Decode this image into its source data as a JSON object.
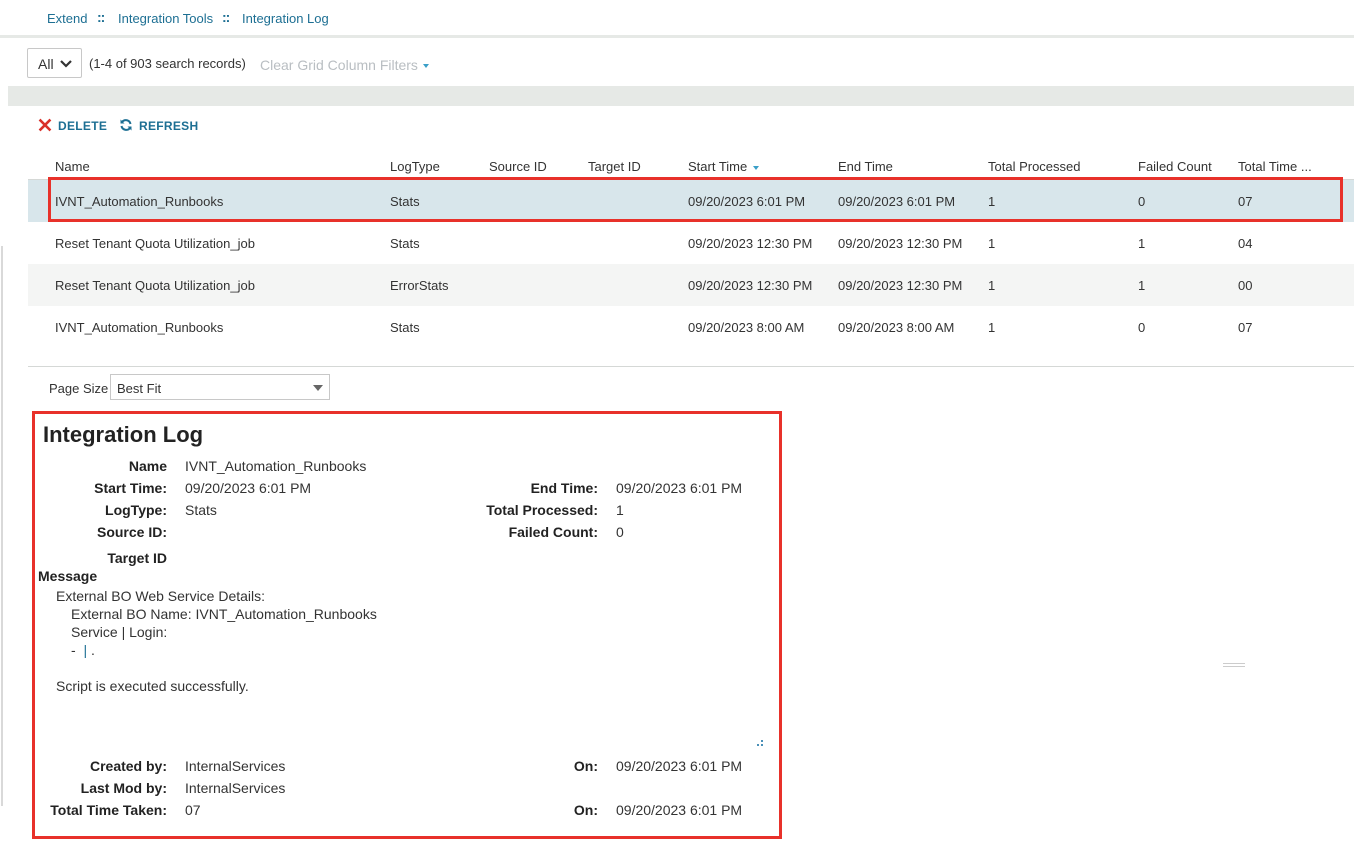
{
  "breadcrumb": {
    "items": [
      "Extend",
      "Integration Tools",
      "Integration Log"
    ],
    "separator": "::"
  },
  "filter": {
    "scope_value": "All",
    "records_text": "(1-4 of 903 search records)",
    "clear_filters_label": "Clear Grid Column Filters"
  },
  "toolbar": {
    "delete_label": "DELETE",
    "refresh_label": "REFRESH"
  },
  "grid": {
    "columns": [
      "Name",
      "LogType",
      "Source ID",
      "Target ID",
      "Start Time",
      "End Time",
      "Total Processed",
      "Failed Count",
      "Total Time ..."
    ],
    "sorted_column": "Start Time",
    "rows": [
      {
        "name": "IVNT_Automation_Runbooks",
        "logtype": "Stats",
        "source_id": "",
        "target_id": "",
        "start": "09/20/2023 6:01 PM",
        "end": "09/20/2023 6:01 PM",
        "processed": "1",
        "failed": "0",
        "total_time": "07"
      },
      {
        "name": "Reset Tenant Quota Utilization_job",
        "logtype": "Stats",
        "source_id": "",
        "target_id": "",
        "start": "09/20/2023 12:30 PM",
        "end": "09/20/2023 12:30 PM",
        "processed": "1",
        "failed": "1",
        "total_time": "04"
      },
      {
        "name": "Reset Tenant Quota Utilization_job",
        "logtype": "ErrorStats",
        "source_id": "",
        "target_id": "",
        "start": "09/20/2023 12:30 PM",
        "end": "09/20/2023 12:30 PM",
        "processed": "1",
        "failed": "1",
        "total_time": "00"
      },
      {
        "name": "IVNT_Automation_Runbooks",
        "logtype": "Stats",
        "source_id": "",
        "target_id": "",
        "start": "09/20/2023 8:00 AM",
        "end": "09/20/2023 8:00 AM",
        "processed": "1",
        "failed": "0",
        "total_time": "07"
      }
    ],
    "page_size_label": "Page Size",
    "page_size_value": "Best Fit"
  },
  "detail": {
    "title": "Integration Log",
    "labels": {
      "name": "Name",
      "start_time": "Start Time:",
      "end_time": "End Time:",
      "logtype": "LogType:",
      "total_processed": "Total Processed:",
      "source_id": "Source ID:",
      "failed_count": "Failed Count:",
      "target_id": "Target ID",
      "message": "Message",
      "created_by": "Created by:",
      "created_on": "On:",
      "last_mod_by": "Last Mod by:",
      "total_time_taken": "Total Time Taken:",
      "last_mod_on": "On:"
    },
    "values": {
      "name": "IVNT_Automation_Runbooks",
      "start_time": "09/20/2023 6:01 PM",
      "end_time": "09/20/2023 6:01 PM",
      "logtype": "Stats",
      "total_processed": "1",
      "source_id": "",
      "failed_count": "0",
      "target_id": "",
      "created_by": "InternalServices",
      "created_on": "09/20/2023 6:01 PM",
      "last_mod_by": "InternalServices",
      "total_time_taken": "07",
      "last_mod_on": "09/20/2023 6:01 PM"
    },
    "message_lines": [
      "External BO Web Service Details:",
      "External BO Name: IVNT_Automation_Runbooks",
      "Service | Login:",
      "Script is executed successfully."
    ],
    "message_dash": "-",
    "message_pipe": "|",
    "message_dot": "."
  },
  "colors": {
    "link": "#1d6f93",
    "delete_icon": "#d9302a",
    "highlight": "#e8312a",
    "selected_row": "#d8e6eb"
  }
}
